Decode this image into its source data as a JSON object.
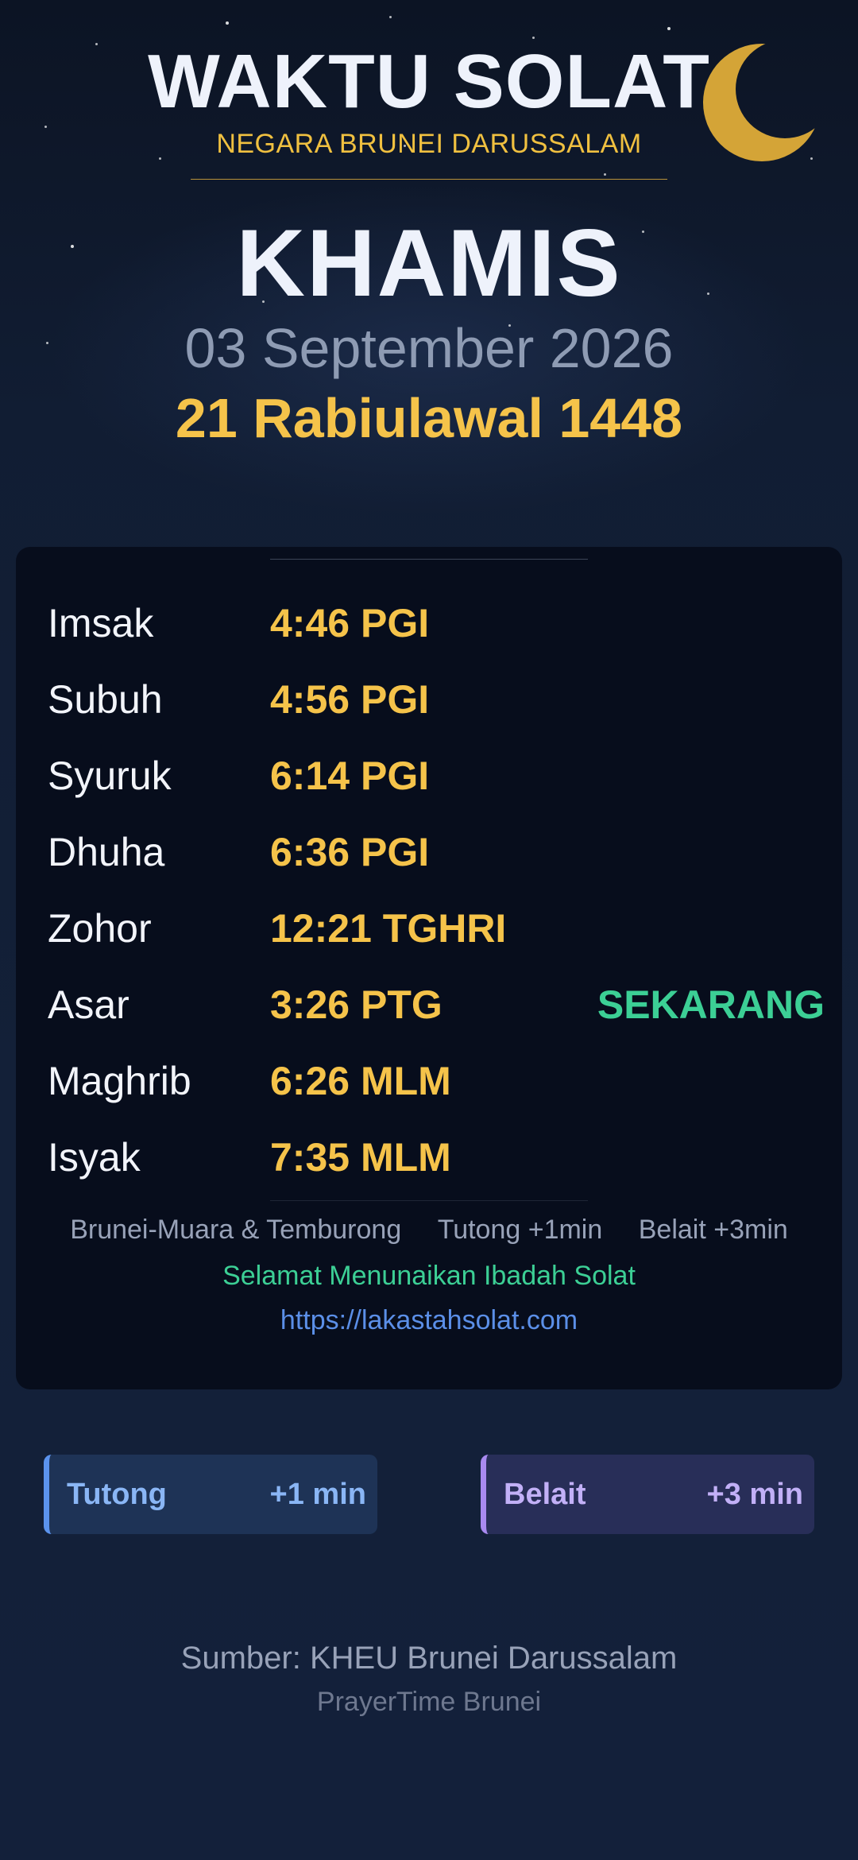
{
  "header": {
    "title": "WAKTU SOLAT",
    "subtitle": "NEGARA BRUNEI DARUSSALAM",
    "moon_icon": "crescent-moon-icon",
    "moon_color": "#d4a437"
  },
  "date": {
    "day": "KHAMIS",
    "gregorian": "03 September 2026",
    "hijri": "21 Rabiulawal 1448"
  },
  "prayers": [
    {
      "name": "Imsak",
      "time": "4:46 PGI",
      "status": ""
    },
    {
      "name": "Subuh",
      "time": "4:56 PGI",
      "status": ""
    },
    {
      "name": "Syuruk",
      "time": "6:14 PGI",
      "status": ""
    },
    {
      "name": "Dhuha",
      "time": "6:36 PGI",
      "status": ""
    },
    {
      "name": "Zohor",
      "time": "12:21 TGHRI",
      "status": ""
    },
    {
      "name": "Asar",
      "time": "3:26 PTG",
      "status": "SEKARANG"
    },
    {
      "name": "Maghrib",
      "time": "6:26 MLM",
      "status": ""
    },
    {
      "name": "Isyak",
      "time": "7:35 MLM",
      "status": ""
    }
  ],
  "footer_card": {
    "districts": [
      "Brunei-Muara & Temburong",
      "Tutong +1min",
      "Belait +3min"
    ],
    "greeting": "Selamat Menunaikan Ibadah Solat",
    "url": "https://lakastahsolat.com"
  },
  "offsets": [
    {
      "district": "Tutong",
      "offset": "+1 min",
      "accent": "#5b93ee"
    },
    {
      "district": "Belait",
      "offset": "+3 min",
      "accent": "#a98af0"
    }
  ],
  "source": {
    "text": "Sumber: KHEU Brunei Darussalam",
    "brand": "PrayerTime Brunei"
  },
  "colors": {
    "gold": "#f5c34a",
    "current": "#3ccf95",
    "link": "#5b8fe8"
  }
}
